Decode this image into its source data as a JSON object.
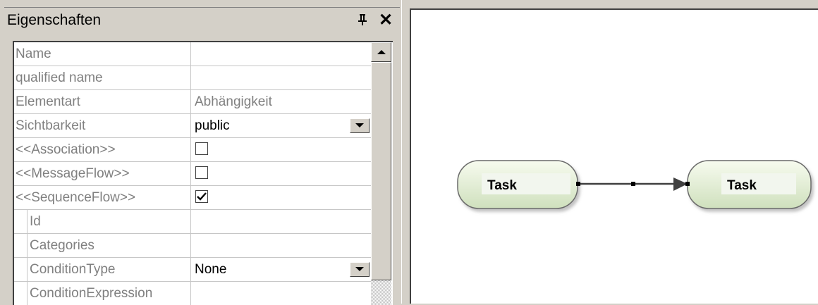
{
  "panel": {
    "title": "Eigenschaften",
    "icons": {
      "pin": "pin-icon",
      "close": "close-icon"
    },
    "rows": [
      {
        "name": "Name",
        "value": "",
        "type": "text"
      },
      {
        "name": "qualified name",
        "value": "",
        "type": "text"
      },
      {
        "name": "Elementart",
        "value": "Abhängigkeit",
        "type": "readonly"
      },
      {
        "name": "Sichtbarkeit",
        "value": "public",
        "type": "dropdown"
      },
      {
        "name": "<<Association>>",
        "checked": false,
        "type": "checkbox"
      },
      {
        "name": "<<MessageFlow>>",
        "checked": false,
        "type": "checkbox"
      },
      {
        "name": "<<SequenceFlow>>",
        "checked": true,
        "type": "checkbox"
      },
      {
        "name": "Id",
        "value": "",
        "type": "text",
        "child": true
      },
      {
        "name": "Categories",
        "value": "",
        "type": "text",
        "child": true
      },
      {
        "name": "ConditionType",
        "value": "None",
        "type": "dropdown",
        "child": true
      },
      {
        "name": "ConditionExpression",
        "value": "",
        "type": "text",
        "child": true
      }
    ]
  },
  "diagram": {
    "tasks": [
      {
        "label": "Task"
      },
      {
        "label": "Task"
      }
    ],
    "connector": "sequence-flow",
    "colors": {
      "task_fill_top": "#f7fbef",
      "task_fill_bottom": "#cfe0bd",
      "task_stroke": "#6b6b6b"
    }
  }
}
